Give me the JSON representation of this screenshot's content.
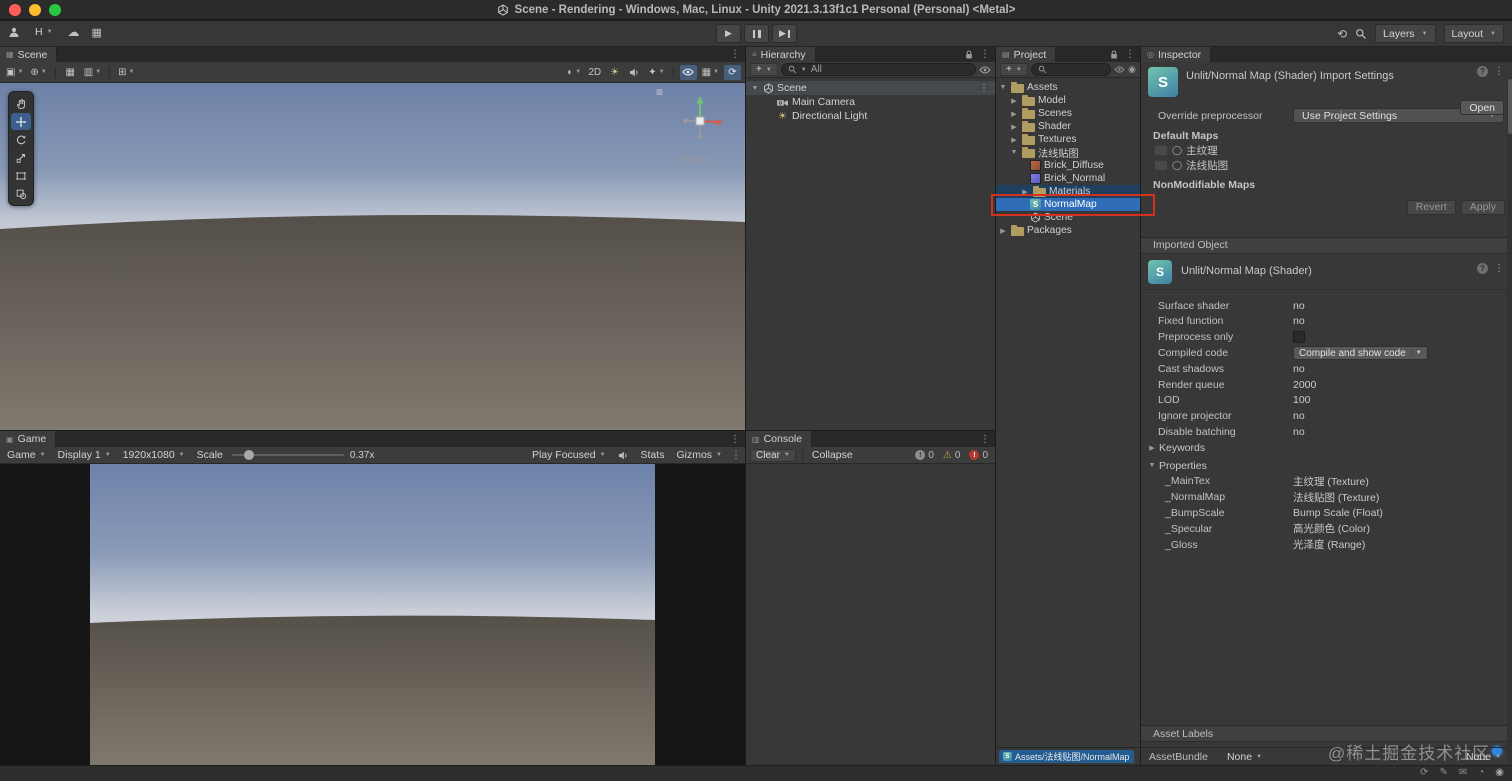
{
  "window": {
    "title": "Scene - Rendering - Windows, Mac, Linux - Unity 2021.3.13f1c1 Personal (Personal) <Metal>"
  },
  "toolbar": {
    "history_label": "H",
    "layers": "Layers",
    "layout": "Layout"
  },
  "scene": {
    "tab": "Scene",
    "mode_2d": "2D",
    "persp": "Persp"
  },
  "game": {
    "tab": "Game",
    "view_menu": "Game",
    "display": "Display 1",
    "resolution": "1920x1080",
    "scale_label": "Scale",
    "scale_value": "0.37x",
    "play_focused": "Play Focused",
    "stats": "Stats",
    "gizmos": "Gizmos"
  },
  "hierarchy": {
    "tab": "Hierarchy",
    "search_scope": "All",
    "items": [
      {
        "label": "Scene",
        "icon": "unity-scene-icon"
      },
      {
        "label": "Main Camera",
        "icon": "camera-icon"
      },
      {
        "label": "Directional Light",
        "icon": "light-icon"
      }
    ]
  },
  "project": {
    "tab": "Project",
    "status_path": "Assets/法线贴图/NormalMap",
    "tree": [
      {
        "label": "Assets",
        "icon": "folder-icon"
      },
      {
        "label": "Model",
        "icon": "folder-icon"
      },
      {
        "label": "Scenes",
        "icon": "folder-icon"
      },
      {
        "label": "Shader",
        "icon": "folder-icon"
      },
      {
        "label": "Textures",
        "icon": "folder-icon"
      },
      {
        "label": "法线贴图",
        "icon": "folder-icon"
      },
      {
        "label": "Brick_Diffuse",
        "icon": "texture-icon"
      },
      {
        "label": "Brick_Normal",
        "icon": "normal-map-icon"
      },
      {
        "label": "Materials",
        "icon": "folder-icon"
      },
      {
        "label": "NormalMap",
        "icon": "shader-icon"
      },
      {
        "label": "Scene",
        "icon": "unity-scene-icon"
      },
      {
        "label": "Packages",
        "icon": "folder-icon"
      }
    ]
  },
  "console": {
    "tab": "Console",
    "clear": "Clear",
    "collapse": "Collapse",
    "info_count": "0",
    "warning_count": "0",
    "error_count": "0"
  },
  "inspector": {
    "tab": "Inspector",
    "title": "Unlit/Normal Map (Shader) Import Settings",
    "open": "Open",
    "override_label": "Override preprocessor",
    "override_value": "Use Project Settings",
    "default_maps": "Default Maps",
    "default_map_1": "主纹理",
    "default_map_2": "法线贴图",
    "nonmodifiable_maps": "NonModifiable Maps",
    "revert": "Revert",
    "apply": "Apply",
    "imported_object": "Imported Object",
    "object_title": "Unlit/Normal Map (Shader)",
    "rows": [
      {
        "label": "Surface shader",
        "value": "no"
      },
      {
        "label": "Fixed function",
        "value": "no"
      },
      {
        "label": "Preprocess only",
        "value": ""
      },
      {
        "label": "Compiled code",
        "value": "Compile and show code"
      },
      {
        "label": "Cast shadows",
        "value": "no"
      },
      {
        "label": "Render queue",
        "value": "2000"
      },
      {
        "label": "LOD",
        "value": "100"
      },
      {
        "label": "Ignore projector",
        "value": "no"
      },
      {
        "label": "Disable batching",
        "value": "no"
      }
    ],
    "keywords": "Keywords",
    "properties": "Properties",
    "props": [
      {
        "name": "_MainTex",
        "value": "主纹理 (Texture)"
      },
      {
        "name": "_NormalMap",
        "value": "法线贴图 (Texture)"
      },
      {
        "name": "_BumpScale",
        "value": "Bump Scale (Float)"
      },
      {
        "name": "_Specular",
        "value": "高光颜色 (Color)"
      },
      {
        "name": "_Gloss",
        "value": "光泽度 (Range)"
      }
    ],
    "asset_labels": "Asset Labels",
    "assetbundle_label": "AssetBundle",
    "assetbundle_value": "None",
    "assetbundle_variant": "None"
  },
  "watermark": "@稀土掘金技术社区",
  "colors": {
    "selection_blue": "#2f6db8",
    "annotation_red": "#d3321f",
    "sky_top": "#6d81a7",
    "sky_horizon": "#d6d9de",
    "ground_top": "#544f49",
    "ground_bottom": "#80796f",
    "folder_icon": "#b09d62",
    "shader_icon_teal": "#6fc4ae",
    "error_red": "#b33a32",
    "warning_yellow": "#c8a53c"
  }
}
